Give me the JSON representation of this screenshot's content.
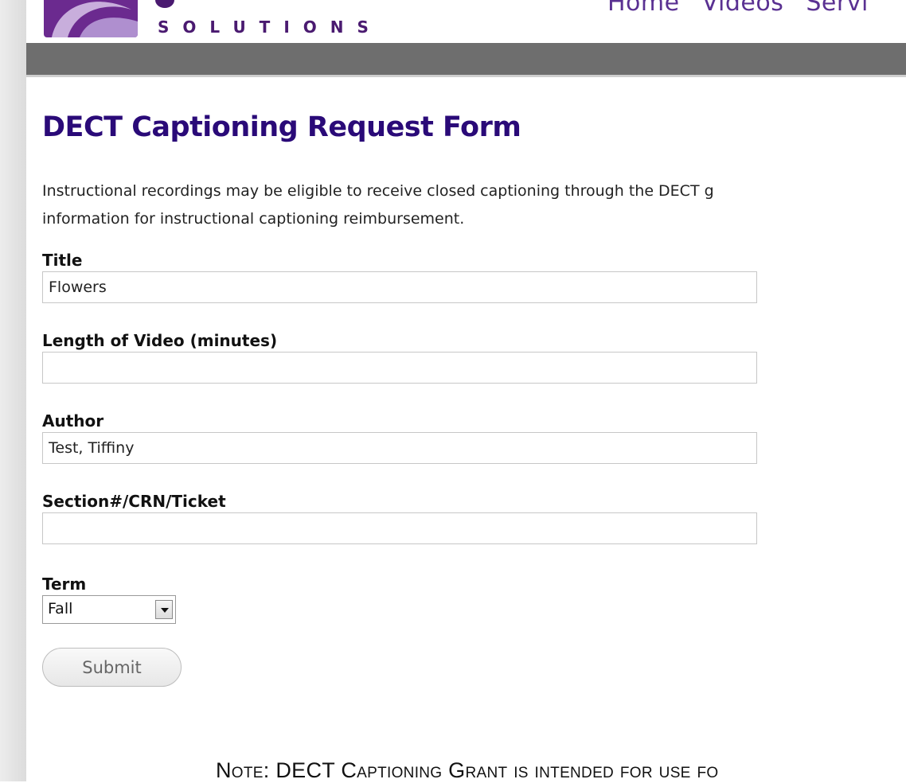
{
  "header": {
    "brand_word": "SOLUTIONS",
    "nav_items": [
      "Home",
      "Videos",
      "Servi"
    ],
    "brand_color": "#6b2a8f",
    "bar_color": "#6e6e6e"
  },
  "form": {
    "title": "DECT Captioning Request Form",
    "intro_line1": "Instructional recordings may be eligible to receive closed captioning through the DECT g",
    "intro_line2": "information for instructional captioning reimbursement.",
    "fields": {
      "title": {
        "label": "Title",
        "value": "Flowers"
      },
      "length": {
        "label": "Length of Video (minutes)",
        "value": ""
      },
      "author": {
        "label": "Author",
        "value": "Test, Tiffiny"
      },
      "section": {
        "label": "Section#/CRN/Ticket",
        "value": ""
      },
      "term": {
        "label": "Term",
        "selected": "Fall"
      }
    },
    "submit_label": "Submit"
  },
  "note": "Note: DECT Captioning Grant is intended for use fo",
  "colors": {
    "title": "#2a0a78",
    "nav": "#5a3192"
  }
}
